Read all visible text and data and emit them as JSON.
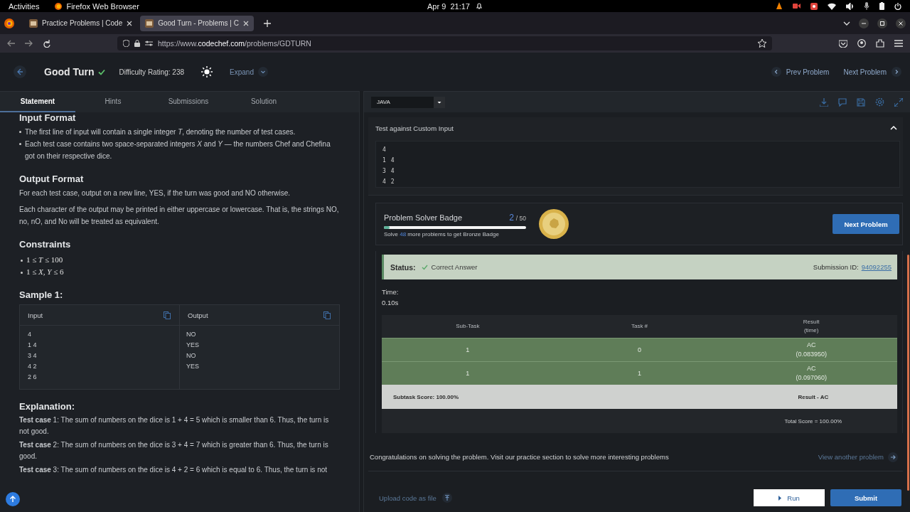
{
  "system_bar": {
    "activities": "Activities",
    "app": "Firefox Web Browser",
    "clock": "Apr 9  21:17"
  },
  "browser": {
    "tabs": [
      {
        "title": "Practice Problems | Code",
        "selected": false
      },
      {
        "title": "Good Turn - Problems | C",
        "selected": true
      }
    ],
    "url": {
      "prefix": "https://www.",
      "host": "codechef.com",
      "path": "/problems/GDTURN"
    }
  },
  "problem": {
    "title": "Good Turn",
    "difficulty": "Difficulty Rating: 238",
    "expand": "Expand",
    "prev": "Prev Problem",
    "next": "Next Problem"
  },
  "tabs": [
    {
      "label": "Statement",
      "selected": true
    },
    {
      "label": "Hints",
      "selected": false
    },
    {
      "label": "Submissions",
      "selected": false
    },
    {
      "label": "Solution",
      "selected": false
    }
  ],
  "language": "JAVA",
  "statement": {
    "input_format": {
      "heading": "Input Format",
      "items": [
        "The first line of input will contain a single integer *T*, denoting the number of test cases.",
        "Each test case contains two space-separated integers *X* and *Y* — the numbers Chef and Chefina got on their respective dice."
      ]
    },
    "output_format": {
      "heading": "Output Format",
      "paragraphs": [
        "For each test case, output on a new line, YES, if the turn was good and NO otherwise.",
        "Each character of the output may be printed in either uppercase or lowercase. That is, the strings NO, no, nO, and No will be treated as equivalent."
      ]
    },
    "constraints": {
      "heading": "Constraints",
      "items": [
        "1 ≤ *T* ≤ 100",
        "1 ≤ *X*, *Y* ≤ 6"
      ]
    },
    "sample": {
      "heading": "Sample 1:",
      "input_label": "Input",
      "output_label": "Output",
      "input_lines": [
        "4",
        "1 4",
        "3 4",
        "4 2",
        "2 6"
      ],
      "output_lines": [
        "NO",
        "YES",
        "NO",
        "YES"
      ]
    },
    "explanation": {
      "heading": "Explanation:",
      "paragraphs": [
        "**Test case** 1: The sum of numbers on the dice is 1 + 4 = 5 which is smaller than 6. Thus, the turn is not good.",
        "**Test case** 2: The sum of numbers on the dice is 3 + 4 = 7 which is greater than 6. Thus, the turn is good.",
        "**Test case** 3: The sum of numbers on the dice is 4 + 2 = 6 which is equal to 6. Thus, the turn is not"
      ]
    }
  },
  "custom_input": {
    "title": "Test against Custom Input",
    "expanded": true,
    "lines": [
      "4",
      "1 4",
      "3 4",
      "4 2"
    ]
  },
  "badge": {
    "title": "Problem Solver Badge",
    "count": "2",
    "total": "/ 50",
    "level": 0.04,
    "hint_before": "Solve",
    "hint_count": "48",
    "hint_after": "more problems to get Bronze Badge",
    "button": "Next Problem"
  },
  "status": {
    "label": "Status:",
    "value": "Correct Answer",
    "submission_label": "Submission ID:",
    "submission_id": "94092255"
  },
  "time": {
    "label": "Time:",
    "value": "0.10s"
  },
  "results": {
    "columns": [
      "Sub-Task",
      "Task #",
      "Result\n(time)"
    ],
    "rows": [
      {
        "cells": [
          "1",
          "0",
          "AC\n(0.083950)"
        ]
      },
      {
        "cells": [
          "1",
          "1",
          "AC\n(0.097060)"
        ]
      }
    ],
    "subtask_score": "Subtask Score: 100.00%",
    "result": "Result - AC",
    "total": "Total Score = 100.00%"
  },
  "congrats": "Congratulations on solving the problem. Visit our practice section to solve more interesting problems",
  "view_another": "View another problem",
  "footer": {
    "upload": "Upload code as file",
    "run": "Run",
    "submit": "Submit"
  }
}
